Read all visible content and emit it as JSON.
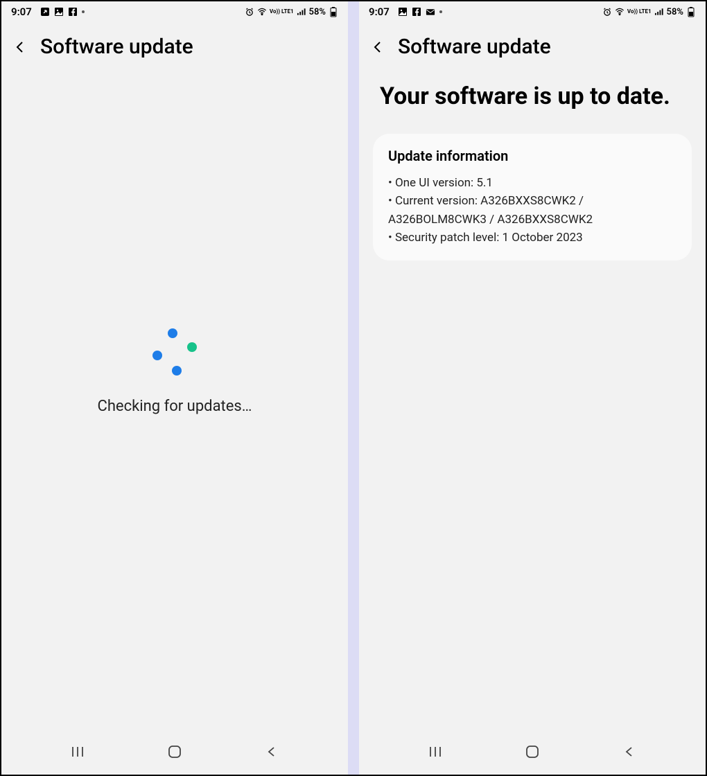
{
  "status": {
    "time": "9:07",
    "battery_text": "58%",
    "volte_label": "Vo)) LTE1"
  },
  "left": {
    "title": "Software update",
    "loading_text": "Checking for updates…"
  },
  "right": {
    "title": "Software update",
    "headline": "Your software is up to date.",
    "card_title": "Update information",
    "rows": {
      "0": "One UI version: 5.1",
      "1": "Current version: A326BXXS8CWK2 / A326BOLM8CWK3 / A326BXXS8CWK2",
      "2": "Security patch level: 1 October 2023"
    }
  }
}
